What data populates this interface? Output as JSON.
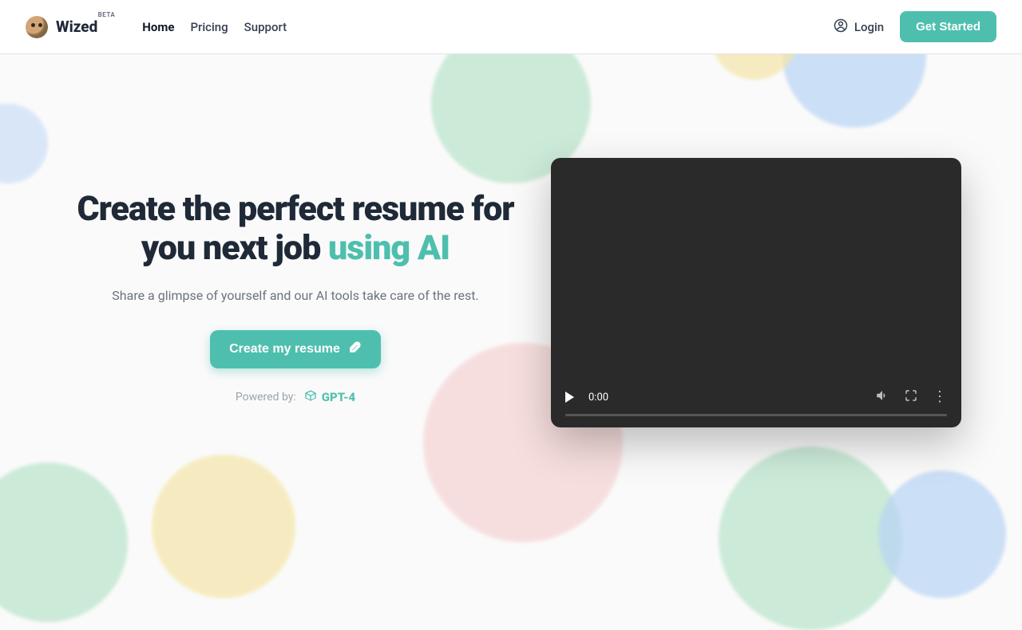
{
  "brand": {
    "name": "Wized",
    "badge": "BETA"
  },
  "nav": {
    "items": [
      {
        "label": "Home",
        "active": true
      },
      {
        "label": "Pricing",
        "active": false
      },
      {
        "label": "Support",
        "active": false
      }
    ],
    "login": "Login",
    "get_started": "Get Started"
  },
  "hero": {
    "title_pre": "Create the perfect resume for you next job ",
    "title_highlight": "using AI",
    "subtitle": "Share a glimpse of yourself and our AI tools take care of the rest.",
    "cta": "Create my resume",
    "powered_label": "Powered by:",
    "powered_model": "GPT-4"
  },
  "video": {
    "time": "0:00"
  },
  "colors": {
    "accent": "#4ebfae"
  }
}
